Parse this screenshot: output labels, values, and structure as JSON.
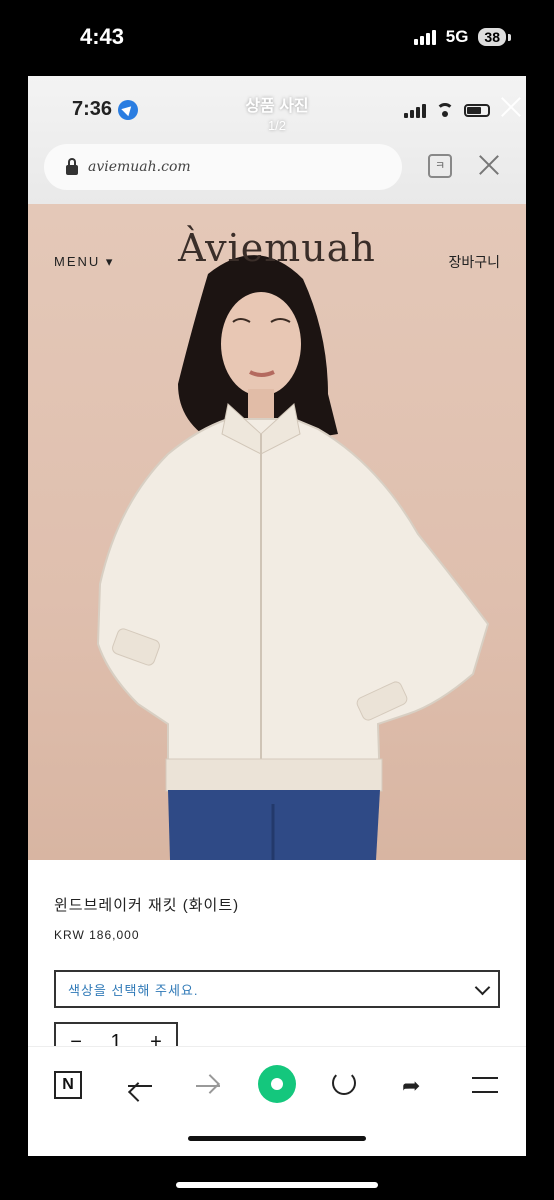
{
  "outer_status": {
    "time": "4:43",
    "network": "5G",
    "battery": "38"
  },
  "viewer": {
    "time": "7:36",
    "title": "상품 사진",
    "counter": "1/2"
  },
  "browser": {
    "url": "aviemuah.com",
    "tab_count": "ㅋ"
  },
  "site": {
    "logo": "Àviemuah",
    "menu": "MENU ▾",
    "cart": "장바구니"
  },
  "product": {
    "name": "윈드브레이커 재킷 (화이트)",
    "price": "KRW 186,000",
    "select_placeholder": "색상을 선택해 주세요.",
    "qty_minus": "−",
    "qty_value": "1",
    "qty_plus": "+"
  },
  "toolbar": {
    "naver": "N"
  },
  "colors": {
    "accent": "#14c77d",
    "hero_bg": "#dfbfae",
    "link": "#2f79b7"
  }
}
